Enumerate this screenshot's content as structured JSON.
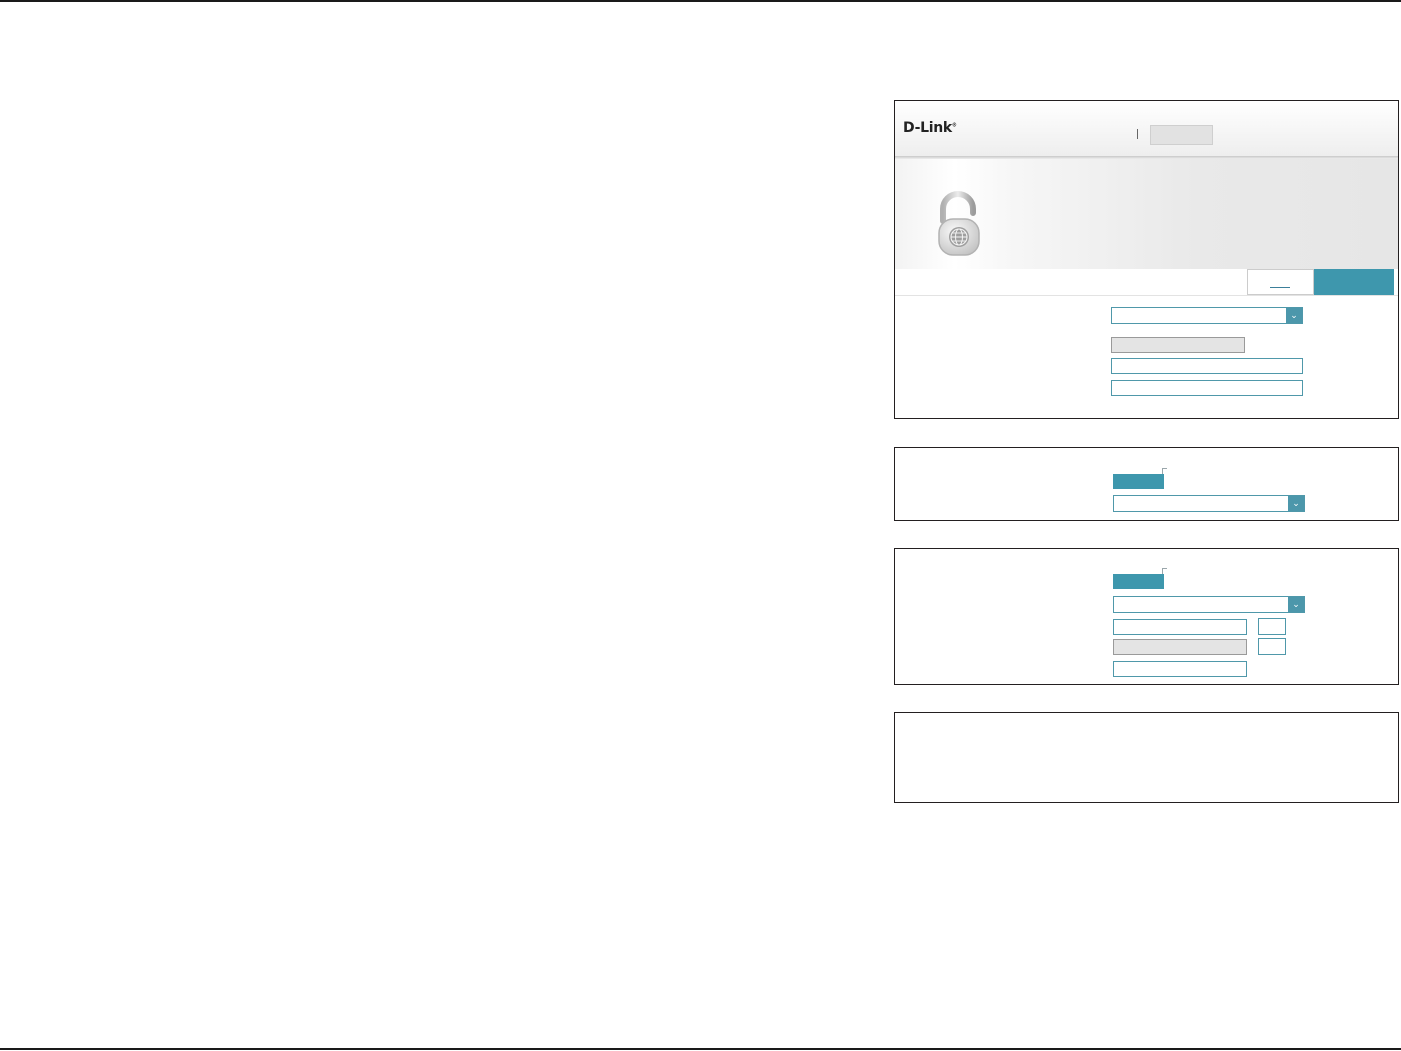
{
  "window": {
    "title": ""
  },
  "header": {
    "logo_text": "D-Link",
    "logo_mark": "®",
    "menu_tab_label": ""
  },
  "banner": {
    "icon": "padlock-globe-icon"
  },
  "tabs": [
    {
      "label": "",
      "state": "inactive"
    },
    {
      "label": "",
      "state": "active"
    }
  ],
  "main_form": {
    "connection_type": {
      "value": ""
    },
    "fields": [
      {
        "value": "",
        "state": "disabled"
      },
      {
        "value": "",
        "state": "enabled"
      },
      {
        "value": "",
        "state": "enabled"
      }
    ]
  },
  "section2": {
    "toggle": {
      "state": "on"
    },
    "select": {
      "value": ""
    }
  },
  "section3": {
    "toggle": {
      "state": "on"
    },
    "select": {
      "value": ""
    },
    "fields": [
      {
        "value": "",
        "small_value": "",
        "state": "enabled"
      },
      {
        "value": "",
        "small_value": "",
        "state": "disabled"
      },
      {
        "value": "",
        "state": "enabled"
      }
    ]
  },
  "section4": {
    "text": ""
  },
  "colors": {
    "accent": "#3e97ad",
    "input_border": "#4f98aa",
    "panel_border": "#231f20",
    "disabled_fill": "#e4e4e4"
  }
}
